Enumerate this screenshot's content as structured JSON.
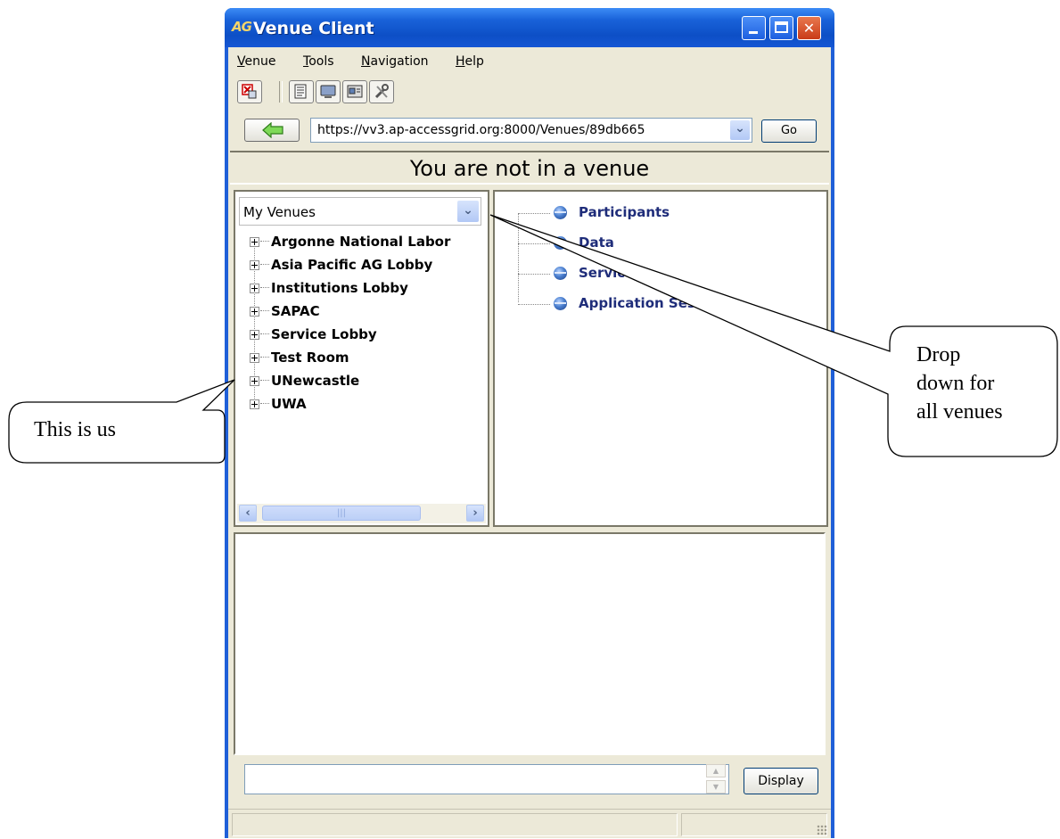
{
  "window": {
    "app_icon_text": "AG",
    "title": "Venue Client"
  },
  "menu": [
    {
      "label": "Venue",
      "mnemonic": "V",
      "rest": "enue"
    },
    {
      "label": "Tools",
      "mnemonic": "T",
      "rest": "ools"
    },
    {
      "label": "Navigation",
      "mnemonic": "N",
      "rest": "avigation"
    },
    {
      "label": "Help",
      "mnemonic": "H",
      "rest": "elp"
    }
  ],
  "toolbar": {
    "icons": [
      "exit-icon",
      "properties-icon",
      "monitor-icon",
      "node-settings-icon",
      "tools-icon"
    ]
  },
  "address": {
    "url": "https://vv3.ap-accessgrid.org:8000/Venues/89db665",
    "go_label": "Go"
  },
  "status_banner": "You are not in a venue",
  "venues": {
    "selector_value": "My Venues",
    "items": [
      "Argonne National Labor",
      "Asia Pacific AG Lobby",
      "Institutions Lobby",
      "SAPAC",
      "Service Lobby",
      "Test Room",
      "UNewcastle",
      "UWA"
    ]
  },
  "sections": [
    "Participants",
    "Data",
    "Services",
    "Application Sessions"
  ],
  "bottom": {
    "display_label": "Display"
  },
  "callouts": {
    "left": "This is us",
    "right_line1": "Drop",
    "right_line2": "down for",
    "right_line3": "all venues"
  },
  "colors": {
    "titlebar": "#0d4fc6",
    "section_text": "#1f2d7a",
    "window_bg": "#ece9d8"
  }
}
